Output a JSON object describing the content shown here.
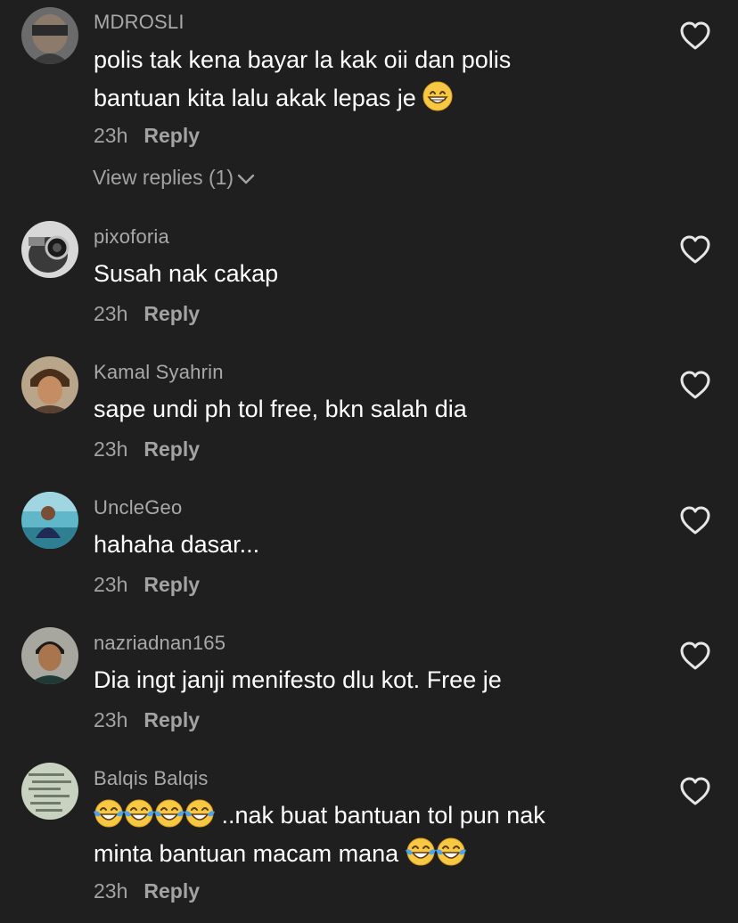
{
  "comments": [
    {
      "username": "MDROSLI",
      "lines": [
        "polis tak kena bayar la kak oii dan polis",
        "bantuan kita lalu akak lepas je"
      ],
      "emoji_line2": "grinning-face-with-smiling-eyes",
      "time": "23h",
      "reply": "Reply",
      "view_replies": "View replies (1)"
    },
    {
      "username": "pixoforia",
      "lines": [
        "Susah nak cakap"
      ],
      "time": "23h",
      "reply": "Reply"
    },
    {
      "username": "Kamal Syahrin",
      "lines": [
        "sape undi ph tol free, bkn salah dia"
      ],
      "time": "23h",
      "reply": "Reply"
    },
    {
      "username": "UncleGeo",
      "lines": [
        "hahaha dasar..."
      ],
      "time": "23h",
      "reply": "Reply"
    },
    {
      "username": "nazriadnan165",
      "lines": [
        "Dia ingt janji menifesto dlu kot. Free je"
      ],
      "time": "23h",
      "reply": "Reply"
    },
    {
      "username": "Balqis Balqis",
      "lines": [
        "..nak buat bantuan tol pun nak",
        "minta bantuan macam mana"
      ],
      "emoji_line1": "face-with-tears-of-joy x4",
      "emoji_line2": "face-with-tears-of-joy x2",
      "time": "23h",
      "reply": "Reply"
    }
  ],
  "colors": {
    "background": "#1f1f1f",
    "username": "#a9a9a9",
    "text": "#ffffff",
    "meta": "#a3a3a3"
  },
  "icons": [
    "heart-outline-icon",
    "chevron-down-icon"
  ]
}
